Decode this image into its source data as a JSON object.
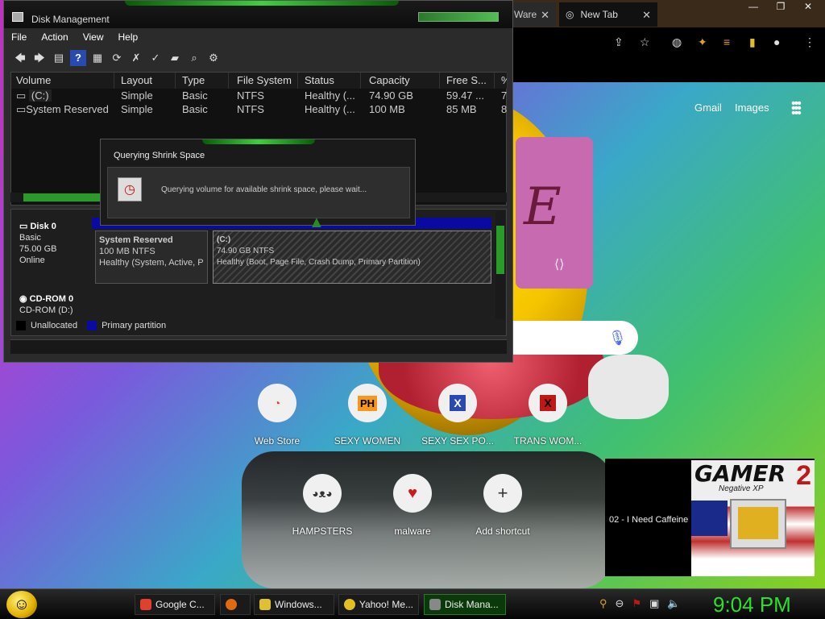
{
  "browser": {
    "tab_partial": "Ware",
    "tab_active": "New Tab",
    "new_tab": "+",
    "links": [
      "Gmail",
      "Images"
    ]
  },
  "shortcuts": [
    {
      "label": "Web Store",
      "icon": "chrome-webstore-icon",
      "glyph": "◔",
      "color": "#e04030"
    },
    {
      "label": "SEXY WOMEN",
      "icon": "pornhub-icon",
      "glyph": "PH",
      "color": "#000"
    },
    {
      "label": "SEXY SEX PO...",
      "icon": "xvideos-icon",
      "glyph": "X",
      "color": "#2a4ab0"
    },
    {
      "label": "TRANS WOM...",
      "icon": "xhamster-icon",
      "glyph": "X",
      "color": "#c01818"
    },
    {
      "label": "HAMPSTERS",
      "icon": "hamster-icon",
      "glyph": "🐹",
      "color": "#333"
    },
    {
      "label": "malware",
      "icon": "heart-icon",
      "glyph": "♥",
      "color": "#d01818"
    },
    {
      "label": "Add shortcut",
      "icon": "plus-icon",
      "glyph": "+",
      "color": "#333"
    }
  ],
  "player": {
    "track": "02 - I Need Caffeine",
    "album_title": "GAMER",
    "album_number": "2",
    "album_sub": "Negative XP"
  },
  "disk_mgmt": {
    "title": "Disk Management",
    "menu": [
      "File",
      "Action",
      "View",
      "Help"
    ],
    "columns": [
      "Volume",
      "Layout",
      "Type",
      "File System",
      "Status",
      "Capacity",
      "Free S...",
      "%"
    ],
    "rows": [
      [
        "(C:)",
        "Simple",
        "Basic",
        "NTFS",
        "Healthy (...",
        "74.90 GB",
        "59.47 ...",
        "7"
      ],
      [
        "System Reserved",
        "Simple",
        "Basic",
        "NTFS",
        "Healthy (...",
        "100 MB",
        "85 MB",
        "8"
      ]
    ],
    "disk0": {
      "name": "Disk 0",
      "kind": "Basic",
      "size": "75.00 GB",
      "state": "Online"
    },
    "part_sys": {
      "name": "System Reserved",
      "size": "100 MB NTFS",
      "status": "Healthy (System, Active, P"
    },
    "part_c": {
      "name": "(C:)",
      "size": "74.90 GB NTFS",
      "status": "Healthy (Boot, Page File, Crash Dump, Primary Partition)"
    },
    "cdrom": {
      "name": "CD-ROM 0",
      "drive": "CD-ROM (D:)"
    },
    "legend": [
      "Unallocated",
      "Primary partition"
    ]
  },
  "dialog": {
    "title": "Querying Shrink Space",
    "message": "Querying volume for available shrink space, please wait..."
  },
  "taskbar": {
    "items": [
      {
        "label": "Google C...",
        "color": "#e04030"
      },
      {
        "label": "",
        "color": "#e06a10"
      },
      {
        "label": "Windows...",
        "color": "#e0c030"
      },
      {
        "label": "Yahoo! Me...",
        "color": "#e0c020"
      },
      {
        "label": "Disk Mana...",
        "color": "#888"
      }
    ],
    "time": "9:04 PM"
  }
}
